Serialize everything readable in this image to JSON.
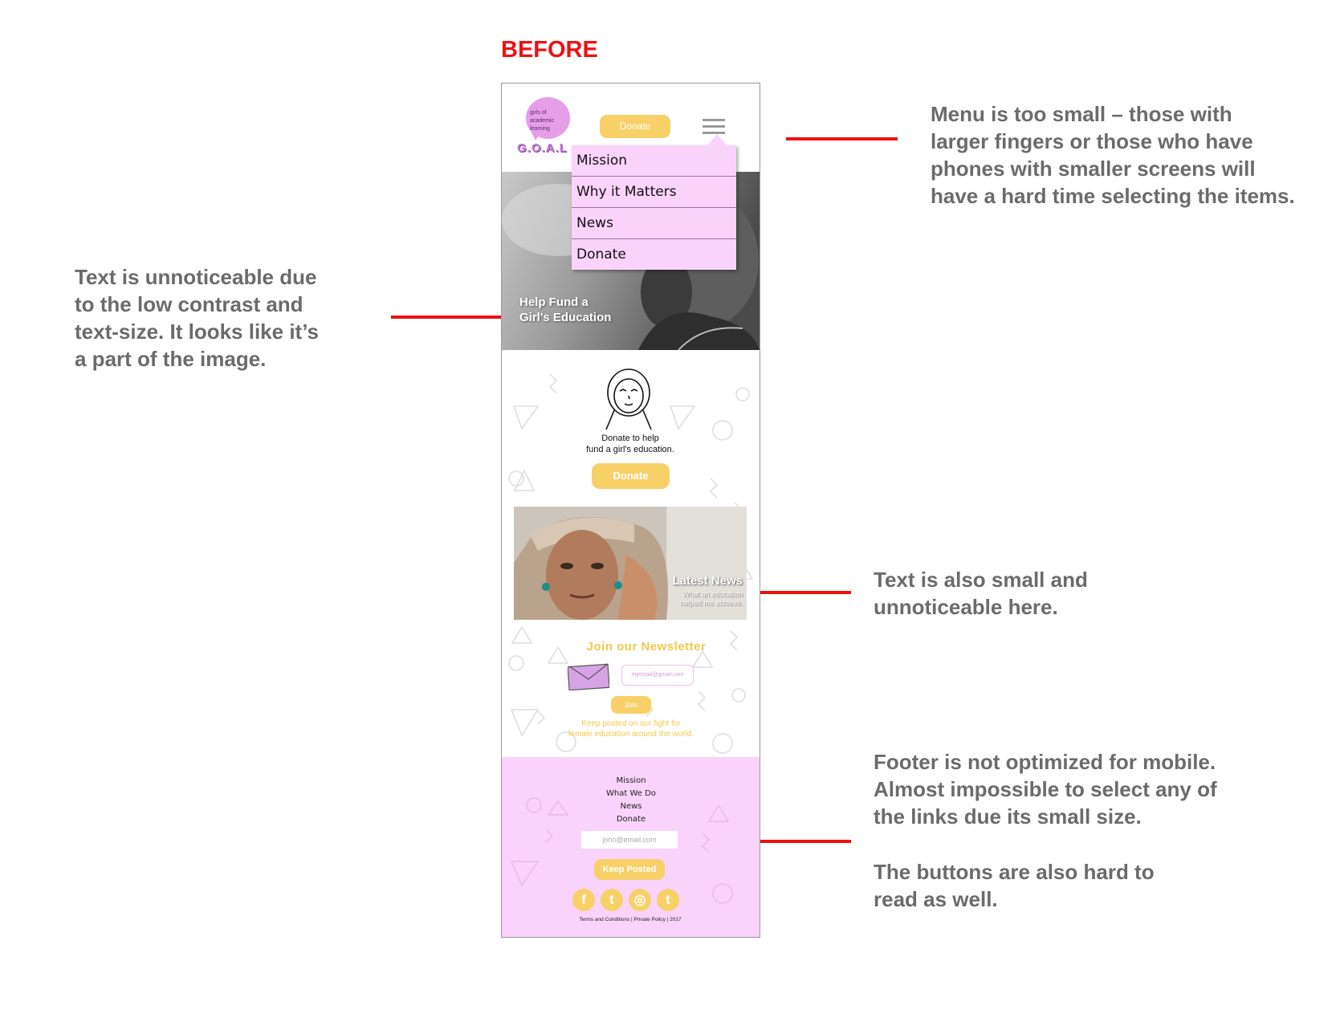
{
  "heading": "BEFORE",
  "annotations": {
    "menu": [
      "Menu is too small – those with",
      "larger fingers or those who have",
      "phones with smaller screens will",
      "have a hard time selecting the items."
    ],
    "hero_text": [
      "Text is unnoticeable due",
      "to the low contrast and",
      "text-size. It looks like it’s",
      "a part of the image."
    ],
    "news_text": [
      "Text is also small and",
      "unnoticeable here."
    ],
    "footer": [
      "Footer is not optimized for mobile.",
      "Almost impossible to select any of",
      "the links due its small size."
    ],
    "buttons": [
      "The buttons are also hard to",
      "read as well."
    ]
  },
  "mockup": {
    "logo": {
      "small_text": [
        "girls of",
        "academic",
        "learning"
      ],
      "name": "G.O.A.L"
    },
    "header_donate": "Donate",
    "menu_items": [
      "Mission",
      "Why it Matters",
      "News",
      "Donate"
    ],
    "hero_text": [
      "Help Fund a",
      "Girl's Education"
    ],
    "donate_help": [
      "Donate to help",
      "fund a girl's education."
    ],
    "donate_button": "Donate",
    "news": {
      "title": "Latest News",
      "subtitle": [
        "What an education",
        "helped me achieve."
      ]
    },
    "newsletter": {
      "title": "Join our Newsletter",
      "placeholder": "myemail@gmail.com",
      "join": "Join",
      "sub": [
        "Keep posted on our fight for",
        "female education around the world."
      ]
    },
    "footer": {
      "links": [
        "Mission",
        "What We Do",
        "News",
        "Donate"
      ],
      "email_placeholder": "john@email.com",
      "button": "Keep Posted",
      "social": [
        "f",
        "t",
        "◎",
        "t"
      ],
      "legal": "Terms and Conditions | Private Policy | 2017"
    }
  },
  "colors": {
    "accent_red": "#ee1111",
    "yellow": "#f7d067",
    "pink": "#f9d3fb",
    "note_gray": "#6b6b6b"
  },
  "icons": [
    "hamburger-menu-icon",
    "hijab-woman-icon",
    "envelope-icon",
    "facebook-icon",
    "twitter-icon",
    "instagram-icon",
    "tumblr-icon"
  ]
}
